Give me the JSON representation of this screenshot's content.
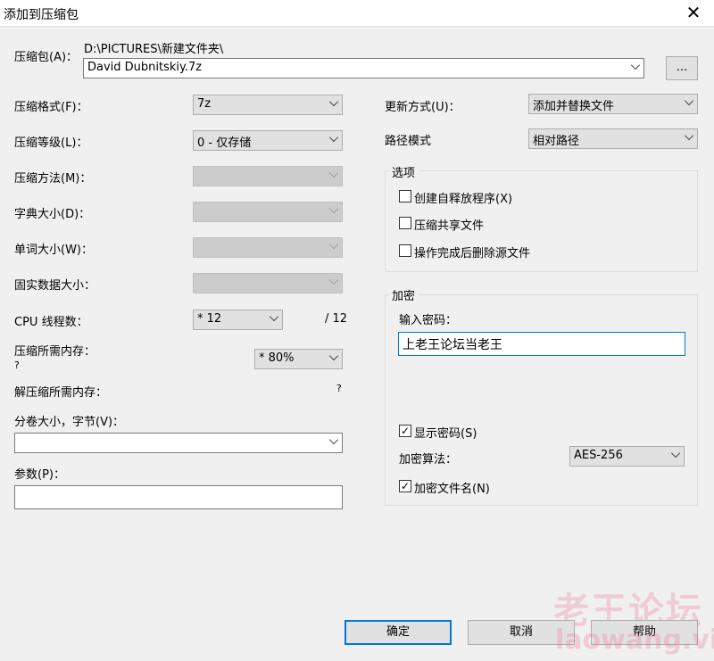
{
  "window": {
    "title": "添加到压缩包",
    "close": "✕"
  },
  "archive": {
    "label": "压缩包(A)：",
    "path": "D:\\PICTURES\\新建文件夹\\",
    "filename": "David Dubnitskiy.7z",
    "browse": "..."
  },
  "left": {
    "format": {
      "label": "压缩格式(F)：",
      "value": "7z"
    },
    "level": {
      "label": "压缩等级(L)：",
      "value": "0 - 仅存储"
    },
    "method": {
      "label": "压缩方法(M)：",
      "value": ""
    },
    "dict": {
      "label": "字典大小(D)：",
      "value": ""
    },
    "word": {
      "label": "单词大小(W)：",
      "value": ""
    },
    "solid": {
      "label": "固实数据大小：",
      "value": ""
    },
    "cpu": {
      "label": "CPU 线程数：",
      "value": "* 12",
      "max": "/ 12"
    },
    "mem": {
      "label": "压缩所需内存：",
      "value": "?",
      "select": "* 80%"
    },
    "dmem": {
      "label": "解压缩所需内存：",
      "value": "?"
    },
    "volume": {
      "label": "分卷大小，字节(V)：",
      "value": ""
    },
    "params": {
      "label": "参数(P)：",
      "value": ""
    }
  },
  "right": {
    "update": {
      "label": "更新方式(U)：",
      "value": "添加并替换文件"
    },
    "pathmode": {
      "label": "路径模式",
      "value": "相对路径"
    },
    "options": {
      "title": "选项",
      "items": [
        {
          "label": "创建自释放程序(X)",
          "checked": false
        },
        {
          "label": "压缩共享文件",
          "checked": false
        },
        {
          "label": "操作完成后删除源文件",
          "checked": false
        }
      ]
    },
    "encryption": {
      "title": "加密",
      "pw_label": "输入密码：",
      "password": "上老王论坛当老王",
      "show": {
        "label": "显示密码(S)",
        "checked": true
      },
      "algo_label": "加密算法：",
      "algo": "AES-256",
      "encnames": {
        "label": "加密文件名(N)",
        "checked": true
      }
    }
  },
  "buttons": {
    "ok": "确定",
    "cancel": "取消",
    "help": "帮助"
  },
  "watermark": {
    "cn": "老王论坛",
    "en": "laowang.vip"
  },
  "colors": {
    "accent": "#0078d7"
  }
}
